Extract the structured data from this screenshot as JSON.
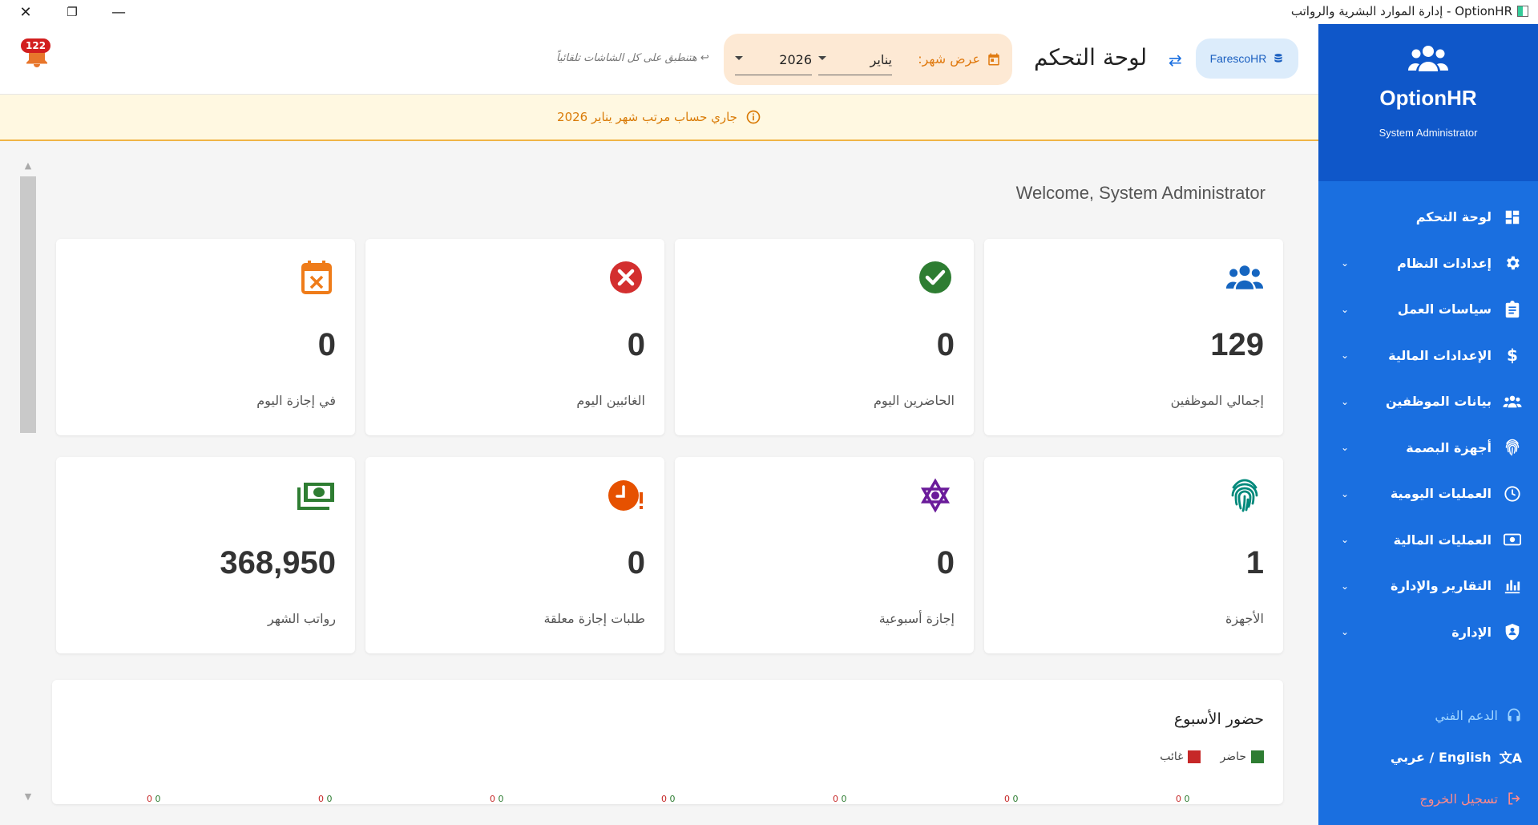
{
  "window": {
    "title": "OptionHR - إدارة الموارد البشرية والرواتب",
    "controls": {
      "close": "✕",
      "maximize": "❐",
      "minimize": "—"
    }
  },
  "header": {
    "notifications_count": "122",
    "auto_apply_hint": "↩ هتنطبق على كل الشاشات تلقائياً",
    "month_label": "عرض شهر:",
    "month_value": "يناير",
    "year_value": "2026",
    "page_title": "لوحة التحكم",
    "company": "FarescoHR"
  },
  "banner": {
    "text": "جاري حساب مرتب شهر يناير 2026"
  },
  "welcome": "Welcome, System Administrator",
  "cards": [
    {
      "value": "129",
      "label": "إجمالي الموظفين",
      "icon": "users-icon",
      "color": "#1565c0"
    },
    {
      "value": "0",
      "label": "الحاضرين اليوم",
      "icon": "check-circle-icon",
      "color": "#2e7d32"
    },
    {
      "value": "0",
      "label": "الغائبين اليوم",
      "icon": "cancel-circle-icon",
      "color": "#d32f2f"
    },
    {
      "value": "0",
      "label": "في إجازة اليوم",
      "icon": "calendar-x-icon",
      "color": "#ef7c1a"
    },
    {
      "value": "1",
      "label": "الأجهزة",
      "icon": "fingerprint-icon",
      "color": "#00897b"
    },
    {
      "value": "0",
      "label": "إجازة أسبوعية",
      "icon": "star-of-david-icon",
      "color": "#6a1b9a"
    },
    {
      "value": "0",
      "label": "طلبات إجازة معلقة",
      "icon": "clock-alert-icon",
      "color": "#e65100"
    },
    {
      "value": "368,950",
      "label": "رواتب الشهر",
      "icon": "cash-icon",
      "color": "#2e7d32"
    }
  ],
  "week_chart": {
    "title": "حضور الأسبوع",
    "legend": [
      {
        "name": "حاضر",
        "color": "#2e7d32"
      },
      {
        "name": "غائب",
        "color": "#c62828"
      }
    ],
    "zero_labels": [
      "0",
      "0"
    ]
  },
  "sidebar": {
    "brand": "OptionHR",
    "role": "System Administrator",
    "items": [
      {
        "label": "لوحة التحكم",
        "icon": "dashboard-icon",
        "expandable": false
      },
      {
        "label": "إعدادات النظام",
        "icon": "gear-icon",
        "expandable": true
      },
      {
        "label": "سياسات العمل",
        "icon": "clipboard-icon",
        "expandable": true
      },
      {
        "label": "الإعدادات المالية",
        "icon": "dollar-icon",
        "expandable": true
      },
      {
        "label": "بيانات الموظفين",
        "icon": "users-icon",
        "expandable": true
      },
      {
        "label": "أجهزة البصمة",
        "icon": "fingerprint-icon",
        "expandable": true
      },
      {
        "label": "العمليات اليومية",
        "icon": "clock-icon",
        "expandable": true
      },
      {
        "label": "العمليات المالية",
        "icon": "money-icon",
        "expandable": true
      },
      {
        "label": "التقارير والإدارة",
        "icon": "bar-chart-icon",
        "expandable": true
      },
      {
        "label": "الإدارة",
        "icon": "shield-user-icon",
        "expandable": true
      }
    ],
    "support": "الدعم الفني",
    "language": "عربي / English",
    "logout": "تسجيل الخروج"
  }
}
